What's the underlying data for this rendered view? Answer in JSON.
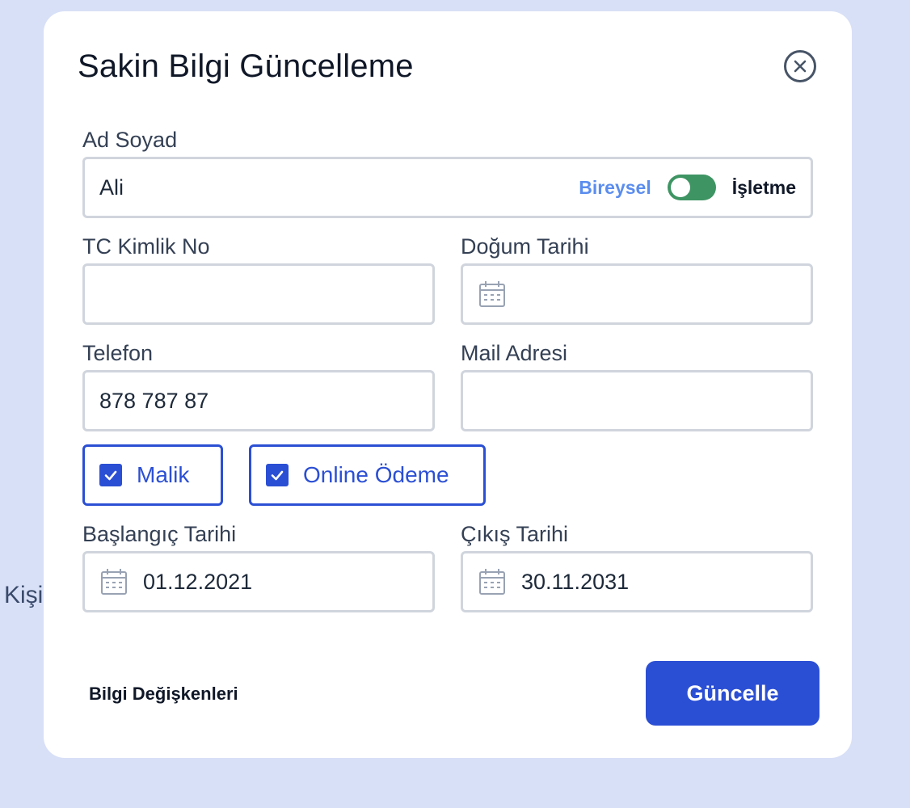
{
  "background": {
    "partial_text": "Kişi"
  },
  "modal": {
    "title": "Sakin Bilgi Güncelleme",
    "close_icon": "close-circle-icon"
  },
  "form": {
    "ad_soyad": {
      "label": "Ad Soyad",
      "value": "Ali",
      "toggle_left": "Bireysel",
      "toggle_right": "İşletme"
    },
    "tc": {
      "label": "TC Kimlik No",
      "value": ""
    },
    "dogum": {
      "label": "Doğum Tarihi",
      "value": "",
      "icon": "calendar-icon"
    },
    "telefon": {
      "label": "Telefon",
      "value": "878 787 87"
    },
    "mail": {
      "label": "Mail Adresi",
      "value": ""
    },
    "checkboxes": [
      {
        "label": "Malik",
        "checked": true
      },
      {
        "label": "Online Ödeme",
        "checked": true
      }
    ],
    "baslangic": {
      "label": "Başlangıç Tarihi",
      "value": "01.12.2021",
      "icon": "calendar-icon"
    },
    "cikis": {
      "label": "Çıkış Tarihi",
      "value": "30.11.2031",
      "icon": "calendar-icon"
    }
  },
  "footer": {
    "link_label": "Bilgi Değişkenleri",
    "submit_label": "Güncelle"
  },
  "colors": {
    "primary": "#2b4fd4",
    "toggle_on": "#3e9463",
    "toggle_label": "#5b8def",
    "background": "#d8e0f7"
  }
}
